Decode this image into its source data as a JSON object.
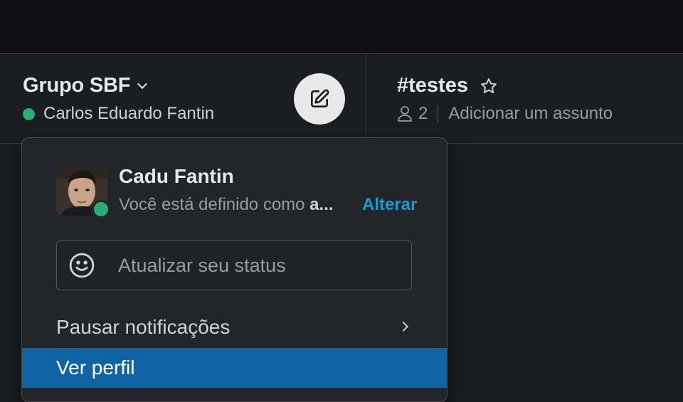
{
  "workspace": {
    "name": "Grupo SBF",
    "current_user": "Carlos Eduardo Fantin"
  },
  "channel": {
    "name": "#testes",
    "member_count": "2",
    "topic_placeholder": "Adicionar um assunto"
  },
  "menu": {
    "profile_name": "Cadu Fantin",
    "status_text": "Você está definido como ",
    "status_emphasis": "a...",
    "change_label": "Alterar",
    "status_input_placeholder": "Atualizar seu status",
    "items": [
      {
        "label": "Pausar notificações"
      },
      {
        "label": "Ver perfil"
      }
    ]
  },
  "colors": {
    "presence": "#2bac76",
    "link": "#1d9bd1",
    "highlight": "#1164a3"
  }
}
